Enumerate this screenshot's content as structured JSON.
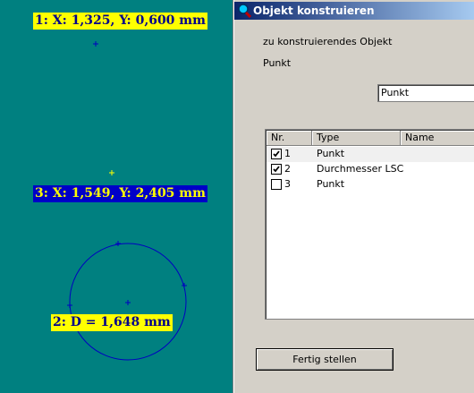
{
  "canvas": {
    "background": "#008080",
    "measurements": [
      {
        "id": 1,
        "text": "1: X: 1,325, Y: 0,600 mm",
        "style": "yellow"
      },
      {
        "id": 3,
        "text": "3: X: 1,549, Y: 2,405 mm",
        "style": "blue"
      },
      {
        "id": 2,
        "text": "2: D = 1,648  mm",
        "style": "yellow"
      }
    ]
  },
  "dialog": {
    "title": "Objekt konstruieren",
    "prompt_label": "zu konstruierendes Objekt",
    "object_name": "Punkt",
    "type_select_value": "Punkt",
    "list": {
      "columns": [
        "Nr.",
        "Type",
        "Name"
      ],
      "rows": [
        {
          "checked": true,
          "nr": "1",
          "type": "Punkt",
          "name": ""
        },
        {
          "checked": true,
          "nr": "2",
          "type": "Durchmesser LSC",
          "name": ""
        },
        {
          "checked": false,
          "nr": "3",
          "type": "Punkt",
          "name": ""
        }
      ]
    },
    "finish_button": "Fertig stellen"
  }
}
